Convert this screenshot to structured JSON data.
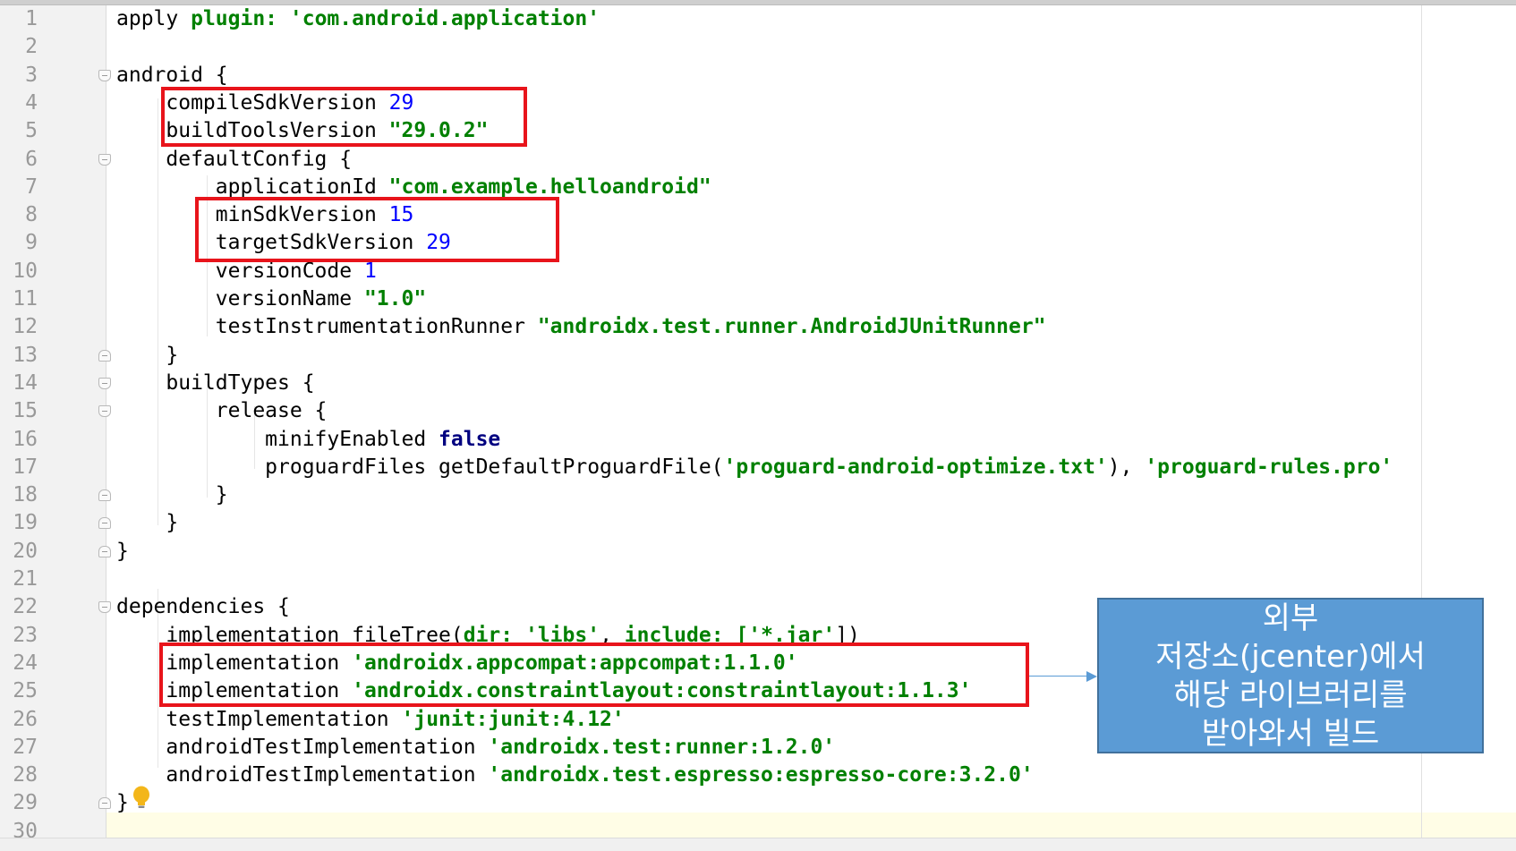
{
  "editor": {
    "line_numbers": [
      "1",
      "2",
      "3",
      "4",
      "5",
      "6",
      "7",
      "8",
      "9",
      "10",
      "11",
      "12",
      "13",
      "14",
      "15",
      "16",
      "17",
      "18",
      "19",
      "20",
      "21",
      "22",
      "23",
      "24",
      "25",
      "26",
      "27",
      "28",
      "29",
      "30"
    ],
    "lines": [
      [
        {
          "t": "apply "
        },
        {
          "t": "plugin: ",
          "c": "named"
        },
        {
          "t": "'com.android.application'",
          "c": "str"
        }
      ],
      [],
      [
        {
          "t": "android {"
        }
      ],
      [
        {
          "t": "    compileSdkVersion "
        },
        {
          "t": "29",
          "c": "num"
        }
      ],
      [
        {
          "t": "    buildToolsVersion "
        },
        {
          "t": "\"29.0.2\"",
          "c": "str"
        }
      ],
      [
        {
          "t": "    defaultConfig {"
        }
      ],
      [
        {
          "t": "        applicationId "
        },
        {
          "t": "\"com.example.helloandroid\"",
          "c": "str"
        }
      ],
      [
        {
          "t": "        minSdkVersion "
        },
        {
          "t": "15",
          "c": "num"
        }
      ],
      [
        {
          "t": "        targetSdkVersion "
        },
        {
          "t": "29",
          "c": "num"
        }
      ],
      [
        {
          "t": "        versionCode "
        },
        {
          "t": "1",
          "c": "num"
        }
      ],
      [
        {
          "t": "        versionName "
        },
        {
          "t": "\"1.0\"",
          "c": "str"
        }
      ],
      [
        {
          "t": "        testInstrumentationRunner "
        },
        {
          "t": "\"androidx.test.runner.AndroidJUnitRunner\"",
          "c": "str"
        }
      ],
      [
        {
          "t": "    }"
        }
      ],
      [
        {
          "t": "    buildTypes {"
        }
      ],
      [
        {
          "t": "        release {"
        }
      ],
      [
        {
          "t": "            minifyEnabled "
        },
        {
          "t": "false",
          "c": "kw"
        }
      ],
      [
        {
          "t": "            proguardFiles getDefaultProguardFile("
        },
        {
          "t": "'proguard-android-optimize.txt'",
          "c": "str"
        },
        {
          "t": "), "
        },
        {
          "t": "'proguard-rules.pro'",
          "c": "str"
        }
      ],
      [
        {
          "t": "        }"
        }
      ],
      [
        {
          "t": "    }"
        }
      ],
      [
        {
          "t": "}"
        }
      ],
      [],
      [
        {
          "t": "dependencies {"
        }
      ],
      [
        {
          "t": "    implementation fileTree("
        },
        {
          "t": "dir: ",
          "c": "named"
        },
        {
          "t": "'libs'",
          "c": "str"
        },
        {
          "t": ", "
        },
        {
          "t": "include: ",
          "c": "named"
        },
        {
          "t": "['*.jar'",
          "c": "str"
        },
        {
          "t": "])"
        }
      ],
      [
        {
          "t": "    implementation "
        },
        {
          "t": "'androidx.appcompat:appcompat:1.1.0'",
          "c": "str"
        }
      ],
      [
        {
          "t": "    implementation "
        },
        {
          "t": "'androidx.constraintlayout:constraintlayout:1.1.3'",
          "c": "str"
        }
      ],
      [
        {
          "t": "    testImplementation "
        },
        {
          "t": "'junit:junit:4.12'",
          "c": "str"
        }
      ],
      [
        {
          "t": "    androidTestImplementation "
        },
        {
          "t": "'androidx.test:runner:1.2.0'",
          "c": "str"
        }
      ],
      [
        {
          "t": "    androidTestImplementation "
        },
        {
          "t": "'androidx.test.espresso:espresso-core:3.2.0'",
          "c": "str"
        }
      ],
      [
        {
          "t": "}"
        }
      ],
      []
    ]
  },
  "callout": {
    "lines": [
      "외부",
      "저장소(jcenter)에서",
      "해당 라이브러리를",
      "받아와서 빌드"
    ]
  },
  "colors": {
    "highlight_box": "#e8141b",
    "callout_fill": "#5b9bd5",
    "string": "#008000",
    "number": "#0000ff",
    "keyword": "#000080"
  },
  "icons": {
    "intention_bulb": "lightbulb-icon"
  }
}
